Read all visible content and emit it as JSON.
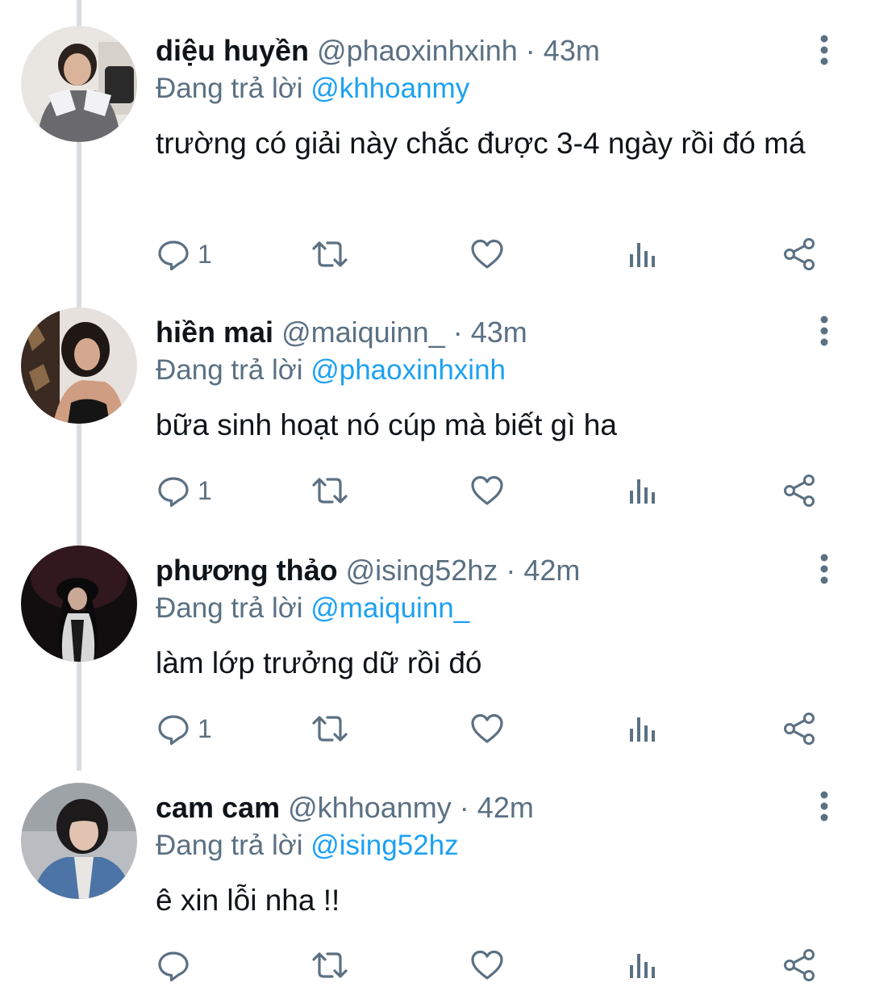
{
  "reply_prefix": "Đang trả lời",
  "tweets": [
    {
      "name": "diệu huyền",
      "handle": "@phaoxinhxinh",
      "separator": "·",
      "time": "43m",
      "reply_to": "@khhoanmy",
      "text": "trường có giải này chắc được 3-4 ngày rồi đó má",
      "reply_count": "1"
    },
    {
      "name": "hiền mai",
      "handle": "@maiquinn_",
      "separator": "·",
      "time": "43m",
      "reply_to": "@phaoxinhxinh",
      "text": "bữa sinh hoạt nó cúp mà biết gì ha",
      "reply_count": "1"
    },
    {
      "name": "phương thảo",
      "handle": "@ising52hz",
      "separator": "·",
      "time": "42m",
      "reply_to": "@maiquinn_",
      "text": "làm lớp trưởng dữ rồi đó",
      "reply_count": "1"
    },
    {
      "name": "cam cam",
      "handle": "@khhoanmy",
      "separator": "·",
      "time": "42m",
      "reply_to": "@ising52hz",
      "text": "ê xin lỗi nha !!",
      "reply_count": ""
    }
  ],
  "icons": {
    "more": "more-vertical-icon",
    "reply": "reply-icon",
    "retweet": "retweet-icon",
    "like": "heart-icon",
    "analytics": "analytics-icon",
    "share": "share-icon"
  },
  "colors": {
    "text": "#0f1419",
    "secondary": "#5b7083",
    "accent": "#1da1f2",
    "thread_line": "#d9dde0"
  }
}
